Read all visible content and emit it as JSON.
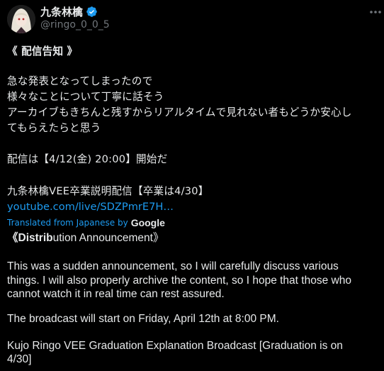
{
  "author": {
    "name": "九条林檎",
    "handle": "@ringo_0_0_5"
  },
  "icons": {
    "verified": "verified-badge-icon",
    "more": "more-horizontal-icon"
  },
  "original_text": {
    "header": "《 配信告知 》",
    "line1": "急な発表となってしまったので",
    "line2": "様々なことについて丁寧に話そう",
    "line3": "アーカイブもきちんと残すからリアルタイムで見れない者もどうか安心し",
    "line4": "てもらえたらと思う",
    "line5": "配信は【4/12(金) 20:00】開始だ",
    "line6": "九条林檎VEE卒業説明配信【卒業は4/30】",
    "link": "youtube.com/live/SDZPmrE7H…"
  },
  "translation": {
    "label": "Translated from Japanese by",
    "brand": "Google",
    "header_bold": "《Distrib",
    "header_rest": "ution Announcement》",
    "p1_line1": "This was a sudden announcement, so I will carefully discuss various",
    "p1_line2": "things. I will also properly archive the content, so I hope that those who",
    "p1_line3": "cannot watch it in real time can rest assured.",
    "p2": "The broadcast will start on Friday, April 12th at 8:00 PM.",
    "p3_line1": "Kujo Ringo VEE Graduation Explanation Broadcast [Graduation is on",
    "p3_line2": "4/30]"
  },
  "colors": {
    "background": "#000000",
    "text": "#e7e9ea",
    "secondary": "#71767b",
    "link": "#1d9bf0"
  }
}
